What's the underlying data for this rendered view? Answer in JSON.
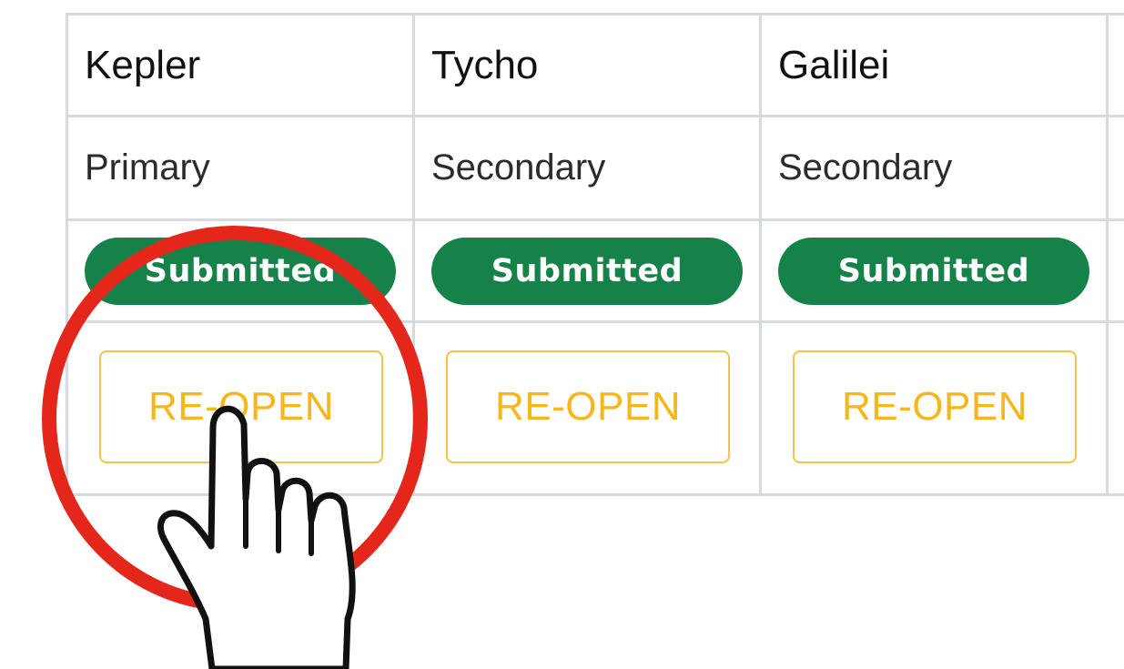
{
  "columns": [
    {
      "name": "Kepler",
      "tier": "Primary",
      "status": "Submitted",
      "action": "RE-OPEN"
    },
    {
      "name": "Tycho",
      "tier": "Secondary",
      "status": "Submitted",
      "action": "RE-OPEN"
    },
    {
      "name": "Galilei",
      "tier": "Secondary",
      "status": "Submitted",
      "action": "RE-OPEN"
    }
  ],
  "colors": {
    "status_badge": "#15824a",
    "reopen_button": "#f6b61c",
    "highlight_circle": "#e5261a",
    "grid_border": "#d7dbe0"
  },
  "overlay": {
    "highlight": "red-circle",
    "pointer": "hand-pointer-icon"
  }
}
